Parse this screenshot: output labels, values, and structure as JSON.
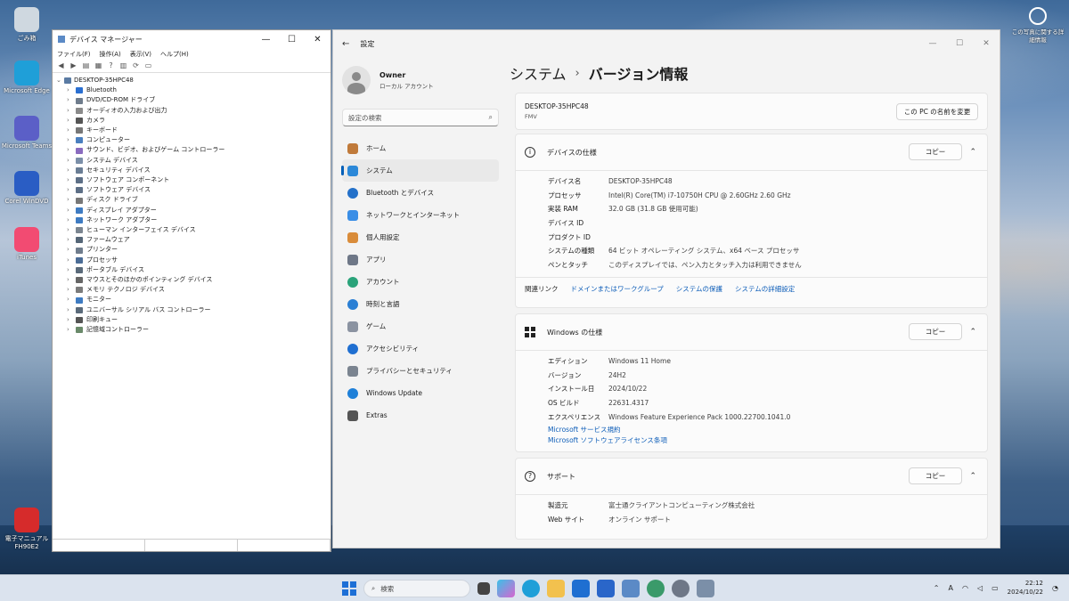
{
  "desktop": {
    "icons": [
      {
        "label": "ごみ箱",
        "icon": "recycle-bin-icon",
        "color": "#cfd8e0"
      },
      {
        "label": "Microsoft Edge",
        "icon": "edge-icon",
        "color": "#1f9fd8"
      },
      {
        "label": "Microsoft Teams",
        "icon": "teams-icon",
        "color": "#5b5fc7"
      },
      {
        "label": "Corel WinDVD",
        "icon": "windvd-icon",
        "color": "#2a5dc4"
      },
      {
        "label": "iTunes",
        "icon": "itunes-icon",
        "color": "#f24b72"
      },
      {
        "label": "電子マニュアル FH90E2",
        "icon": "manual-icon",
        "color": "#d62b2b"
      }
    ],
    "corner_widget": "この写真に関する詳細情報"
  },
  "device_manager": {
    "title": "デバイス マネージャー",
    "menu": [
      "ファイル(F)",
      "操作(A)",
      "表示(V)",
      "ヘルプ(H)"
    ],
    "computer": "DESKTOP-35HPC48",
    "categories": [
      "Bluetooth",
      "DVD/CD-ROM ドライブ",
      "オーディオの入力および出力",
      "カメラ",
      "キーボード",
      "コンピューター",
      "サウンド、ビデオ、およびゲーム コントローラー",
      "システム デバイス",
      "セキュリティ デバイス",
      "ソフトウェア コンポーネント",
      "ソフトウェア デバイス",
      "ディスク ドライブ",
      "ディスプレイ アダプター",
      "ネットワーク アダプター",
      "ヒューマン インターフェイス デバイス",
      "ファームウェア",
      "プリンター",
      "プロセッサ",
      "ポータブル デバイス",
      "マウスとそのほかのポインティング デバイス",
      "メモリ テクノロジ デバイス",
      "モニター",
      "ユニバーサル シリアル バス コントローラー",
      "印刷キュー",
      "記憶域コントローラー"
    ]
  },
  "settings": {
    "title": "設定",
    "profile": {
      "name": "Owner",
      "account_type": "ローカル アカウント"
    },
    "search_placeholder": "設定の検索",
    "nav": [
      {
        "label": "ホーム",
        "icon": "home-icon",
        "color": "#c07a3a"
      },
      {
        "label": "システム",
        "icon": "system-icon",
        "color": "#2b88d8",
        "active": true
      },
      {
        "label": "Bluetooth とデバイス",
        "icon": "bluetooth-icon",
        "color": "#2471c9"
      },
      {
        "label": "ネットワークとインターネット",
        "icon": "network-icon",
        "color": "#3a8ee6"
      },
      {
        "label": "個人用設定",
        "icon": "brush-icon",
        "color": "#d98c3a"
      },
      {
        "label": "アプリ",
        "icon": "apps-icon",
        "color": "#6e7787"
      },
      {
        "label": "アカウント",
        "icon": "account-icon",
        "color": "#2aa37a"
      },
      {
        "label": "時刻と言語",
        "icon": "clock-globe-icon",
        "color": "#2a7fd4"
      },
      {
        "label": "ゲーム",
        "icon": "gamepad-icon",
        "color": "#8b93a1"
      },
      {
        "label": "アクセシビリティ",
        "icon": "accessibility-icon",
        "color": "#1f6fd1"
      },
      {
        "label": "プライバシーとセキュリティ",
        "icon": "shield-icon",
        "color": "#7b8490"
      },
      {
        "label": "Windows Update",
        "icon": "update-icon",
        "color": "#1f80d8"
      },
      {
        "label": "Extras",
        "icon": "extras-icon",
        "color": "#555555"
      }
    ],
    "breadcrumb": {
      "parent": "システム",
      "separator": "›",
      "current": "バージョン情報"
    },
    "pc": {
      "name": "DESKTOP-35HPC48",
      "model": "FMV",
      "rename_button": "この PC の名前を変更"
    },
    "device_spec": {
      "title": "デバイスの仕様",
      "copy_button": "コピー",
      "rows": [
        {
          "k": "デバイス名",
          "v": "DESKTOP-35HPC48"
        },
        {
          "k": "プロセッサ",
          "v": "Intel(R) Core(TM) i7-10750H CPU @ 2.60GHz   2.60 GHz"
        },
        {
          "k": "実装 RAM",
          "v": "32.0 GB (31.8 GB 使用可能)"
        },
        {
          "k": "デバイス ID",
          "v": ""
        },
        {
          "k": "プロダクト ID",
          "v": ""
        },
        {
          "k": "システムの種類",
          "v": "64 ビット オペレーティング システム、x64 ベース プロセッサ"
        },
        {
          "k": "ペンとタッチ",
          "v": "このディスプレイでは、ペン入力とタッチ入力は利用できません"
        }
      ],
      "related_label": "関連リンク",
      "related_links": [
        "ドメインまたはワークグループ",
        "システムの保護",
        "システムの詳細設定"
      ]
    },
    "windows_spec": {
      "title": "Windows の仕様",
      "copy_button": "コピー",
      "rows": [
        {
          "k": "エディション",
          "v": "Windows 11 Home"
        },
        {
          "k": "バージョン",
          "v": "24H2"
        },
        {
          "k": "インストール日",
          "v": "2024/10/22"
        },
        {
          "k": "OS ビルド",
          "v": "22631.4317"
        },
        {
          "k": "エクスペリエンス",
          "v": "Windows Feature Experience Pack 1000.22700.1041.0"
        }
      ],
      "links": [
        "Microsoft サービス規約",
        "Microsoft ソフトウェアライセンス条項"
      ]
    },
    "support": {
      "title": "サポート",
      "copy_button": "コピー",
      "rows": [
        {
          "k": "製造元",
          "v": "富士通クライアントコンピューティング株式会社"
        },
        {
          "k": "Web サイト",
          "v": "オンライン サポート",
          "link": true
        }
      ]
    }
  },
  "taskbar": {
    "search_placeholder": "検索",
    "ime": "A",
    "time": "22:12",
    "date": "2024/10/22"
  }
}
